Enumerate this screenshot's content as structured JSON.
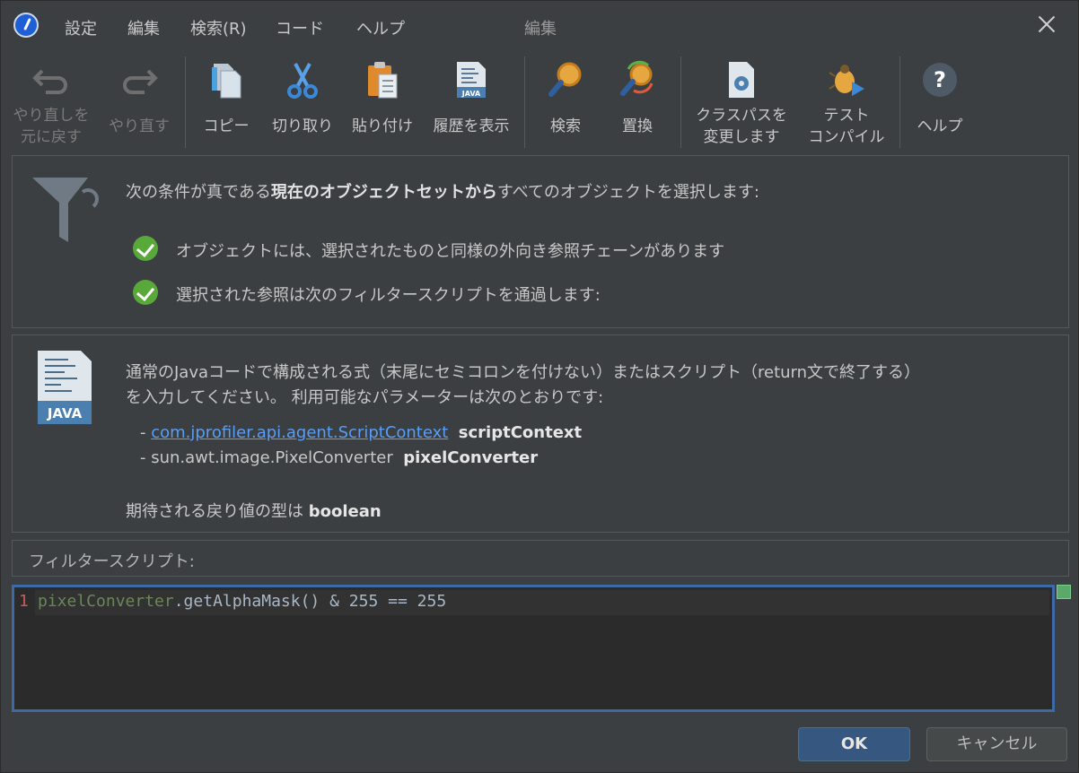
{
  "window": {
    "title": "編集",
    "menu": [
      "設定",
      "編集",
      "検索(R)",
      "コード",
      "ヘルプ"
    ]
  },
  "toolbar": {
    "undo": {
      "line1": "やり直しを",
      "line2": "元に戻す"
    },
    "redo": "やり直す",
    "copy": "コピー",
    "cut": "切り取り",
    "paste": "貼り付け",
    "history": "履歴を表示",
    "find": "検索",
    "replace": "置換",
    "classpath": {
      "line1": "クラスパスを",
      "line2": "変更します"
    },
    "test_compile": {
      "line1": "テスト",
      "line2": "コンパイル"
    },
    "help": "ヘルプ"
  },
  "filter_panel": {
    "intro_before": "次の条件が真である",
    "intro_bold": "現在のオブジェクトセットから",
    "intro_after": "すべてのオブジェクトを選択します:",
    "conditions": [
      "オブジェクトには、選択されたものと同様の外向き参照チェーンがあります",
      "選択された参照は次のフィルタースクリプトを通過します:"
    ]
  },
  "script_info": {
    "description_line1": "通常のJavaコードで構成される式（末尾にセミコロンを付けない）またはスクリプト（return文で終了する）",
    "description_line2": "を入力してください。 利用可能なパラメーターは次のとおりです:",
    "params": [
      {
        "type": "com.jprofiler.api.agent.ScriptContext",
        "name": "scriptContext"
      },
      {
        "type": "sun.awt.image.PixelConverter",
        "name": "pixelConverter"
      }
    ],
    "return_prefix": "期待される戻り値の型は",
    "return_type": "boolean",
    "icon_label": "JAVA"
  },
  "editor": {
    "label": "フィルタースクリプト:",
    "line_number": "1",
    "code_var": "pixelConverter",
    "code_rest": ".getAlphaMask() & 255 == 255"
  },
  "buttons": {
    "ok": "OK",
    "cancel": "キャンセル"
  },
  "colors": {
    "accent": "#365880",
    "editor_border": "#3d6aa6",
    "check": "#59a83a",
    "link": "#589df6"
  }
}
